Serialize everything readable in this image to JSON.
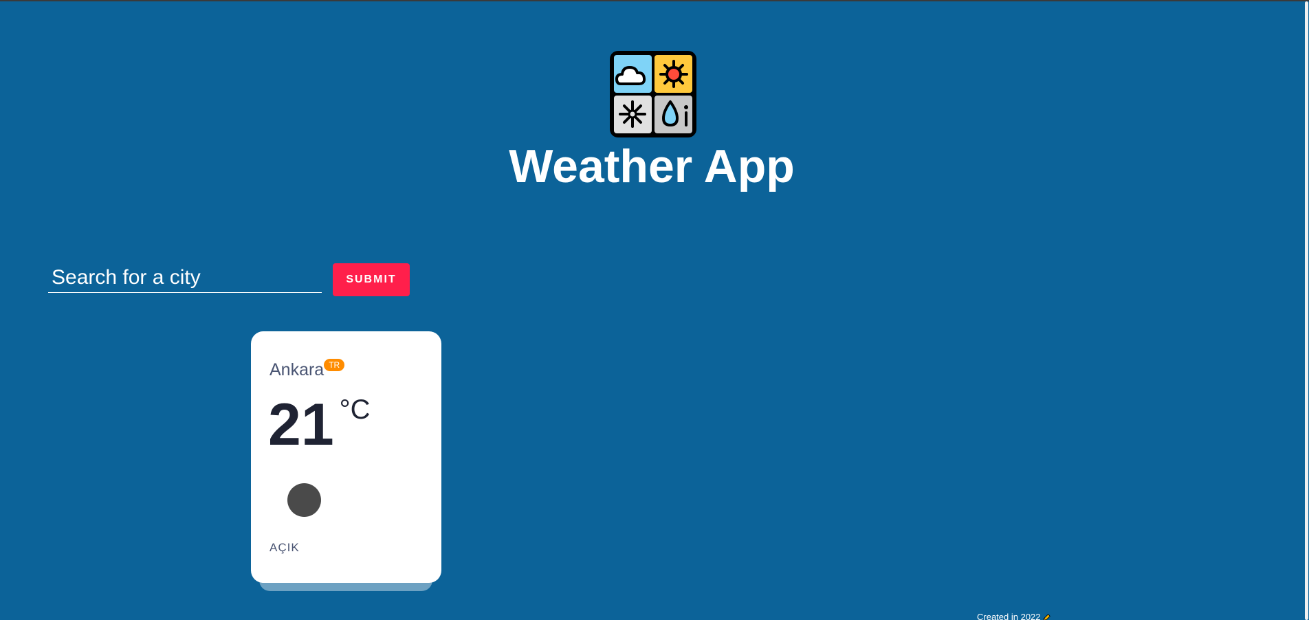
{
  "header": {
    "title": "Weather App",
    "logo_icon": "weather-logo-icon"
  },
  "search": {
    "placeholder": "Search for a city",
    "value": "",
    "submit_label": "SUBMIT"
  },
  "cards": [
    {
      "city": "Ankara",
      "country": "TR",
      "temperature": "21",
      "unit": "°C",
      "description": "AÇIK",
      "icon": "weather-condition-icon"
    }
  ],
  "footer": {
    "text": "Created in 2022",
    "icon": "pencil-icon"
  },
  "colors": {
    "background": "#0c6399",
    "submit": "#ff1f4b",
    "badge": "#ff8c00",
    "card": "#ffffff"
  }
}
